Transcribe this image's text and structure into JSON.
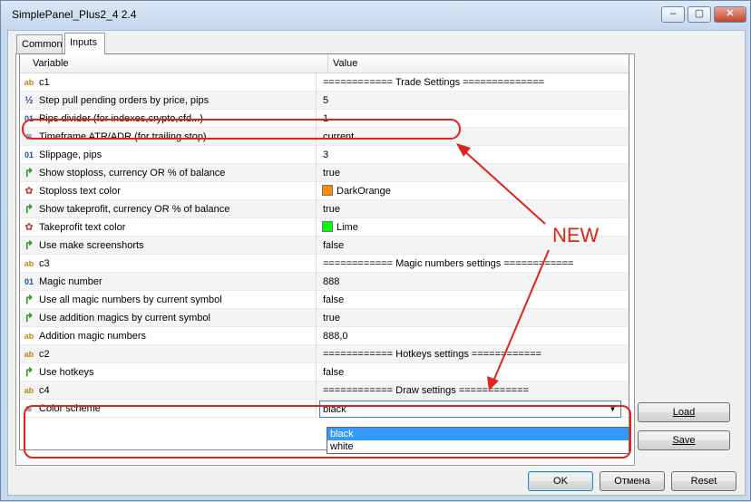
{
  "window": {
    "title": "SimplePanel_Plus2_4 2.4",
    "controls": [
      "–",
      "▢",
      "✕"
    ]
  },
  "tabs": [
    {
      "label": "Common",
      "active": false
    },
    {
      "label": "Inputs",
      "active": true
    }
  ],
  "grid": {
    "columns": [
      "Variable",
      "Value"
    ],
    "rows": [
      {
        "icon": "ab-icon",
        "variable": "c1",
        "value": "============ Trade Settings =============="
      },
      {
        "icon": "fraction-icon",
        "variable": "Step pull pending orders by price, pips",
        "value": "5"
      },
      {
        "icon": "integer-icon",
        "variable": "Pips divider (for indexes,crypto,cfd...)",
        "value": "1"
      },
      {
        "icon": "enum-icon",
        "variable": "Timeframe ATR/ADR (for trailing stop)",
        "value": "current"
      },
      {
        "icon": "integer-icon",
        "variable": "Slippage, pips",
        "value": "3"
      },
      {
        "icon": "bool-icon",
        "variable": "Show stoploss, currency OR % of balance",
        "value": "true"
      },
      {
        "icon": "color-icon",
        "variable": "Stoploss text color",
        "value": "DarkOrange",
        "swatch": "#ff8c00"
      },
      {
        "icon": "bool-icon",
        "variable": "Show takeprofit, currency OR % of balance",
        "value": "true"
      },
      {
        "icon": "color-icon",
        "variable": "Takeprofit text color",
        "value": "Lime",
        "swatch": "#00ff00"
      },
      {
        "icon": "bool-icon",
        "variable": "Use make screenshorts",
        "value": "false"
      },
      {
        "icon": "ab-icon",
        "variable": "c3",
        "value": "============ Magic numbers settings ============"
      },
      {
        "icon": "integer-icon",
        "variable": "Magic number",
        "value": "888"
      },
      {
        "icon": "bool-icon",
        "variable": "Use all magic numbers by current symbol",
        "value": "false"
      },
      {
        "icon": "bool-icon",
        "variable": "Use addition magics by current symbol",
        "value": "true"
      },
      {
        "icon": "ab-icon",
        "variable": "Addition magic numbers",
        "value": "888,0"
      },
      {
        "icon": "ab-icon",
        "variable": "c2",
        "value": "============ Hotkeys settings ============"
      },
      {
        "icon": "bool-icon",
        "variable": "Use hotkeys",
        "value": "false"
      },
      {
        "icon": "ab-icon",
        "variable": "c4",
        "value": "============ Draw settings ============"
      }
    ],
    "edit_row": {
      "icon": "enum-icon",
      "variable": "Color scheme",
      "value": "black"
    },
    "dropdown_options": [
      "black",
      "white"
    ],
    "dropdown_selected": "black"
  },
  "buttons": {
    "load": "Load",
    "save": "Save",
    "ok": "OK",
    "cancel": "Отмена",
    "reset": "Reset"
  },
  "annotation": {
    "label": "NEW",
    "color": "#e2231a"
  }
}
